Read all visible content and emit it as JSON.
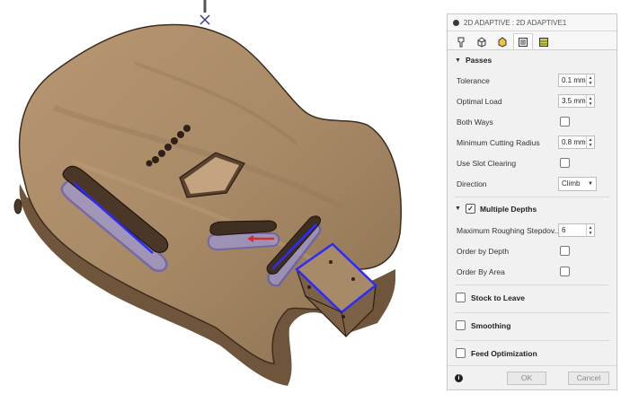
{
  "panel": {
    "title": "2D ADAPTIVE : 2D ADAPTIVE1",
    "tabs": [
      {
        "icon": "tool-icon"
      },
      {
        "icon": "geometry-icon"
      },
      {
        "icon": "heights-icon"
      },
      {
        "icon": "passes-icon"
      },
      {
        "icon": "linking-icon"
      }
    ],
    "passes": {
      "heading": "Passes",
      "tolerance": {
        "label": "Tolerance",
        "value": "0.1 mm"
      },
      "optimal_load": {
        "label": "Optimal Load",
        "value": "3.5 mm"
      },
      "both_ways": {
        "label": "Both Ways",
        "checked": false
      },
      "min_radius": {
        "label": "Minimum Cutting Radius",
        "value": "0.8 mm"
      },
      "slot_clearing": {
        "label": "Use Slot Clearing",
        "checked": false
      },
      "direction": {
        "label": "Direction",
        "value": "Climb"
      }
    },
    "multiple_depths": {
      "heading": "Multiple Depths",
      "checked": true,
      "max_stepdown": {
        "label": "Maximum Roughing Stepdov...",
        "value": "6"
      },
      "order_by_depth": {
        "label": "Order by Depth",
        "checked": false
      },
      "order_by_area": {
        "label": "Order By Area",
        "checked": false
      }
    },
    "groups": {
      "stock_to_leave": "Stock to Leave",
      "smoothing": "Smoothing",
      "feed_optimization": "Feed Optimization"
    },
    "buttons": {
      "ok": "OK",
      "cancel": "Cancel"
    }
  },
  "colors": {
    "wood": "#a98b66",
    "wood_edge": "#7b6145",
    "toolpath": "#2b2bff",
    "toolpath_fill": "#9a9aee",
    "panel_bg": "#f1f1f1"
  }
}
